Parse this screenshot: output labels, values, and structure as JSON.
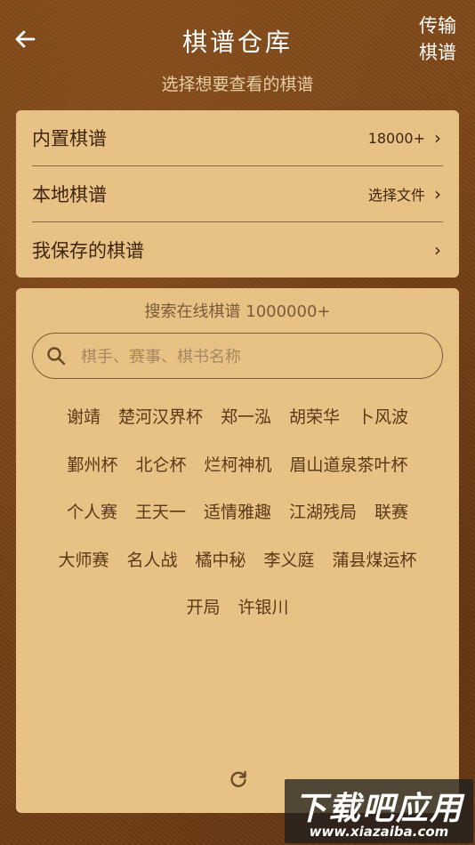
{
  "header": {
    "title": "棋谱仓库",
    "transfer_line1": "传输",
    "transfer_line2": "棋谱",
    "subtitle": "选择想要查看的棋谱"
  },
  "menu": {
    "items": [
      {
        "label": "内置棋谱",
        "value": "18000+"
      },
      {
        "label": "本地棋谱",
        "value": "选择文件"
      },
      {
        "label": "我保存的棋谱",
        "value": ""
      }
    ]
  },
  "search": {
    "title": "搜索在线棋谱 1000000+",
    "placeholder": "棋手、赛事、棋书名称"
  },
  "tags": {
    "row1": [
      "谢靖",
      "楚河汉界杯",
      "郑一泓",
      "胡荣华",
      "卜风波"
    ],
    "row2": [
      "鄞州杯",
      "北仑杯",
      "烂柯神机",
      "眉山道泉茶叶杯"
    ],
    "row3": [
      "个人赛",
      "王天一",
      "适情雅趣",
      "江湖残局",
      "联赛"
    ],
    "row4": [
      "大师赛",
      "名人战",
      "橘中秘",
      "李义庭",
      "蒲县煤运杯"
    ],
    "row5": [
      "开局",
      "许银川"
    ]
  },
  "watermark": {
    "main": "下载吧应用",
    "sub": "www.xiazaiba.com"
  },
  "colors": {
    "card": "#e8c284",
    "background": "#7a4417",
    "text": "#3f2410"
  }
}
